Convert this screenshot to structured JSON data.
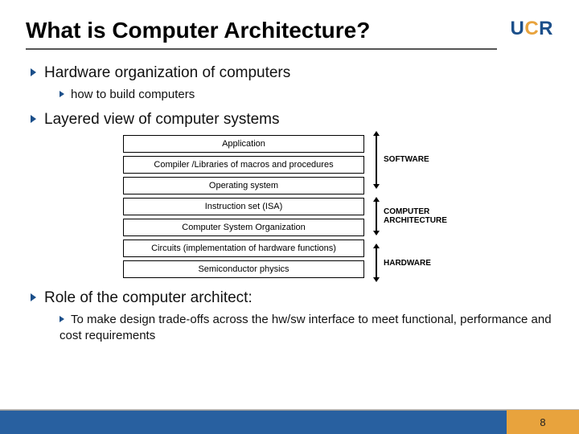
{
  "title": "What is Computer Architecture?",
  "logo": {
    "u": "U",
    "c": "C",
    "r": "R"
  },
  "bullets": {
    "b1": "Hardware organization of computers",
    "b1_1": "how to build computers",
    "b2": "Layered view of computer systems",
    "b3": "Role of the computer architect:",
    "b3_1": "To make design trade-offs across the hw/sw interface to meet functional, performance and cost requirements"
  },
  "diagram": {
    "boxes": {
      "r0": "Application",
      "r1": "Compiler /Libraries of macros and procedures",
      "r2": "Operating system",
      "r3": "Instruction set (ISA)",
      "r4": "Computer System Organization",
      "r5": "Circuits (implementation of hardware functions)",
      "r6": "Semiconductor physics"
    },
    "labels": {
      "software": "SOFTWARE",
      "arch": "COMPUTER ARCHITECTURE",
      "hardware": "HARDWARE"
    }
  },
  "page_number": "8"
}
